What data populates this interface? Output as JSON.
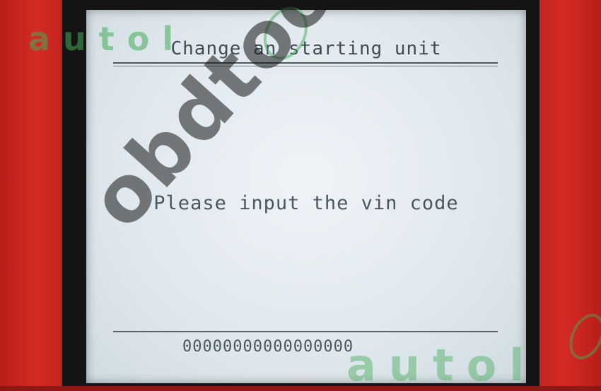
{
  "screen": {
    "title": "Change an starting unit",
    "prompt": "Please input the vin code",
    "vin_value": "00000000000000000"
  },
  "watermark": {
    "brand": "autol",
    "diagonal_text": "obdtoolshop"
  },
  "colors": {
    "device_red": "#c52520",
    "bezel": "#141414",
    "lcd_background": "#e4ebf0",
    "lcd_text": "#4a575c",
    "watermark_green": "#46aa5a"
  }
}
